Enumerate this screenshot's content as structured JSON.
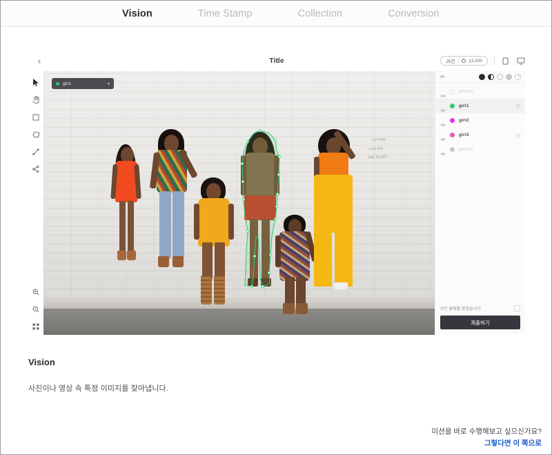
{
  "tabs": [
    {
      "label": "Vision",
      "active": true
    },
    {
      "label": "Time Stamp",
      "active": false
    },
    {
      "label": "Collection",
      "active": false
    },
    {
      "label": "Conversion",
      "active": false
    }
  ],
  "workspace": {
    "back_icon": "chevron-left-icon",
    "title": "Title",
    "count_pill": {
      "items_label": "25건",
      "separator": "|",
      "points_icon": "coin-icon",
      "points_label": "13,200"
    },
    "header_icons": [
      {
        "name": "mobile-preview-icon"
      },
      {
        "name": "desktop-preview-icon"
      }
    ]
  },
  "toolbar": {
    "tools": [
      {
        "name": "cursor-tool",
        "glyph": "➤",
        "selected": true
      },
      {
        "name": "pan-hand-tool",
        "glyph": "✋",
        "selected": false
      },
      {
        "name": "bounding-box-tool",
        "glyph": "▢",
        "selected": false
      },
      {
        "name": "polygon-tool",
        "glyph": "⬟",
        "selected": false
      },
      {
        "name": "line-tool",
        "glyph": "╱",
        "selected": false
      },
      {
        "name": "share-node-tool",
        "glyph": "⁂",
        "selected": false
      }
    ],
    "bottom_tools": [
      {
        "name": "zoom-in-tool",
        "glyph": "+"
      },
      {
        "name": "zoom-out-tool",
        "glyph": "−"
      },
      {
        "name": "fit-to-screen-tool",
        "glyph": "⌗"
      }
    ]
  },
  "canvas": {
    "label_dropdown": {
      "value": "girl1",
      "dot_color": "#2ecc71",
      "caret_icon": "chevron-down-icon"
    },
    "wall_scribbles": [
      "FUTURE",
      "LIFE  BIG",
      "THE  RULES"
    ]
  },
  "side_panel": {
    "opacity_controls": [
      {
        "name": "opacity-solid",
        "style": "op-solid"
      },
      {
        "name": "opacity-half",
        "style": "op-half"
      },
      {
        "name": "opacity-empty",
        "style": "op-empty",
        "selected": true
      },
      {
        "name": "opacity-dot",
        "style": "op-dot"
      },
      {
        "name": "opacity-timer",
        "style": "op-clock"
      }
    ],
    "objects": [
      {
        "name": "person",
        "color": "#ffffff",
        "muted": true,
        "active": false,
        "action": ""
      },
      {
        "name": "girl1",
        "color": "#2ecc71",
        "muted": false,
        "active": true,
        "action": "☰"
      },
      {
        "name": "girl2",
        "color": "#e832e8",
        "muted": false,
        "active": false,
        "action": ""
      },
      {
        "name": "girl3",
        "color": "#e85ab8",
        "muted": false,
        "active": false,
        "action": "◎",
        "action_warn": true
      },
      {
        "name": "person",
        "color": "#c6c6cc",
        "muted": true,
        "active": false,
        "action": ""
      }
    ],
    "confirm": {
      "label": "모든 물체를 찾았습니다",
      "help_icon": "question-circle-icon",
      "checkbox_name": "found-all-objects-checkbox"
    },
    "submit_label": "제출하기"
  },
  "description": {
    "title": "Vision",
    "text": "사진이나 영상 속 특정 이미지를 찾아냅니다."
  },
  "footer": {
    "question": "미션을 바로 수행해보고 싶으신가요?",
    "link_prefix": "그렇다면 ",
    "link_emph": "이 쪽으로"
  },
  "colors": {
    "accent_green": "#2ecc71",
    "accent_magenta": "#e832e8",
    "accent_pink": "#e85ab8",
    "link_blue": "#1a66d0",
    "dark_button": "#36363c"
  }
}
